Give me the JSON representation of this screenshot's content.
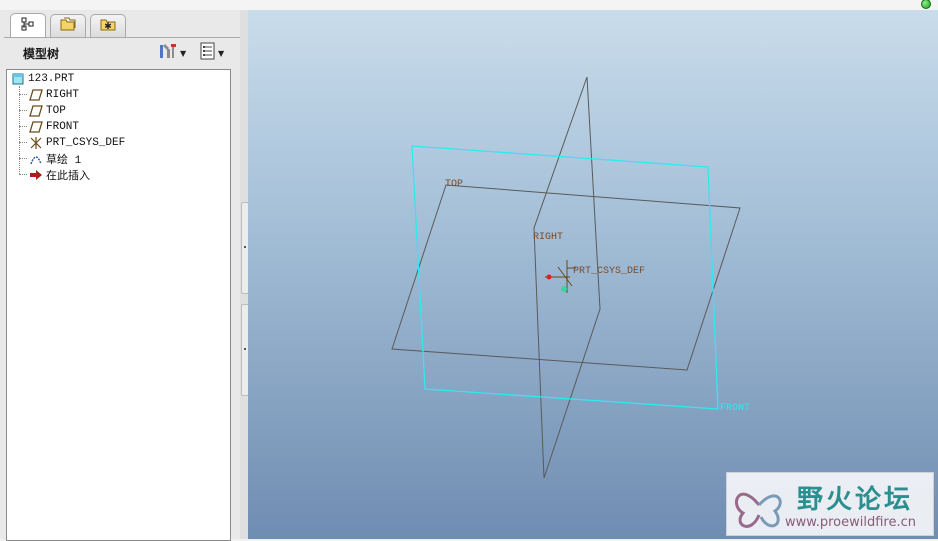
{
  "window": {
    "status_indicator": "green-dot"
  },
  "left_panel": {
    "tabs": [
      {
        "icon": "model-tree-icon",
        "active": true
      },
      {
        "icon": "folder-browser-icon",
        "active": false
      },
      {
        "icon": "favorites-icon",
        "active": false
      }
    ],
    "title": "模型树",
    "tools": {
      "settings_icon": "tree-settings-icon",
      "columns_icon": "tree-columns-icon"
    }
  },
  "model_tree": {
    "root": {
      "label": "123.PRT",
      "icon": "part-icon"
    },
    "items": [
      {
        "label": "RIGHT",
        "icon": "datum-plane-icon"
      },
      {
        "label": "TOP",
        "icon": "datum-plane-icon"
      },
      {
        "label": "FRONT",
        "icon": "datum-plane-icon"
      },
      {
        "label": "PRT_CSYS_DEF",
        "icon": "coordinate-system-icon"
      },
      {
        "label": "草绘 1",
        "icon": "sketch-icon"
      },
      {
        "label": "在此插入",
        "icon": "insert-here-arrow-icon"
      }
    ]
  },
  "viewport": {
    "labels": {
      "top": "TOP",
      "right": "RIGHT",
      "csys": "PRT_CSYS_DEF",
      "front": "FRONT"
    },
    "colors": {
      "plane_gray": "#5a5a5a",
      "plane_cyan": "#30e8f0",
      "label_brown": "#7a4a2a"
    }
  },
  "watermark": {
    "title": "野火论坛",
    "url": "www.proewildfire.cn"
  }
}
